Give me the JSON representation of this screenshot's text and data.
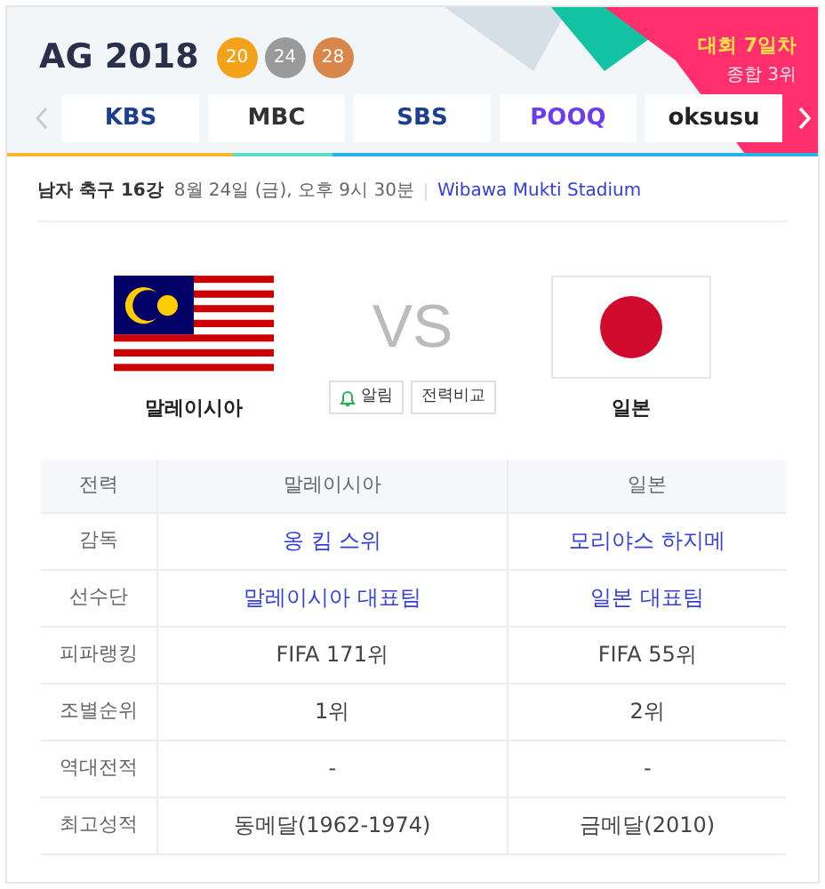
{
  "header": {
    "logo": "AG 2018",
    "medals": [
      {
        "count": "20",
        "color": "#f5a21b"
      },
      {
        "count": "24",
        "color": "#9a9a9a"
      },
      {
        "count": "28",
        "color": "#d9864a"
      }
    ],
    "day": "대회 7일차",
    "rank": "종합 3위"
  },
  "broadcasters": [
    {
      "name": "KBS",
      "color": "#1d3f8f"
    },
    {
      "name": "MBC",
      "color": "#333333"
    },
    {
      "name": "SBS",
      "color": "#1d3f8f"
    },
    {
      "name": "POOQ",
      "color": "#6a3df0"
    },
    {
      "name": "oksusu",
      "color": "#222222"
    }
  ],
  "match": {
    "title": "남자 축구 16강",
    "datetime": "8월 24일 (금), 오후 9시 30분",
    "venue": "Wibawa Mukti Stadium",
    "vs": "VS",
    "home": "말레이시아",
    "away": "일본",
    "buttons": [
      "알림",
      "전력비교"
    ]
  },
  "table": {
    "columns": [
      "전력",
      "말레이시아",
      "일본"
    ],
    "rows": [
      {
        "label": "감독",
        "kind": "link",
        "home": "옹 킴 스위",
        "away": "모리야스 하지메"
      },
      {
        "label": "선수단",
        "kind": "link",
        "home": "말레이시아 대표팀",
        "away": "일본 대표팀"
      },
      {
        "label": "피파랭킹",
        "kind": "text",
        "home": "FIFA 171위",
        "away": "FIFA 55위"
      },
      {
        "label": "조별순위",
        "kind": "text",
        "home": "1위",
        "away": "2위"
      },
      {
        "label": "역대전적",
        "kind": "text",
        "home": "-",
        "away": "-"
      },
      {
        "label": "최고성적",
        "kind": "text",
        "home": "동메달(1962-1974)",
        "away": "금메달(2010)"
      }
    ]
  }
}
